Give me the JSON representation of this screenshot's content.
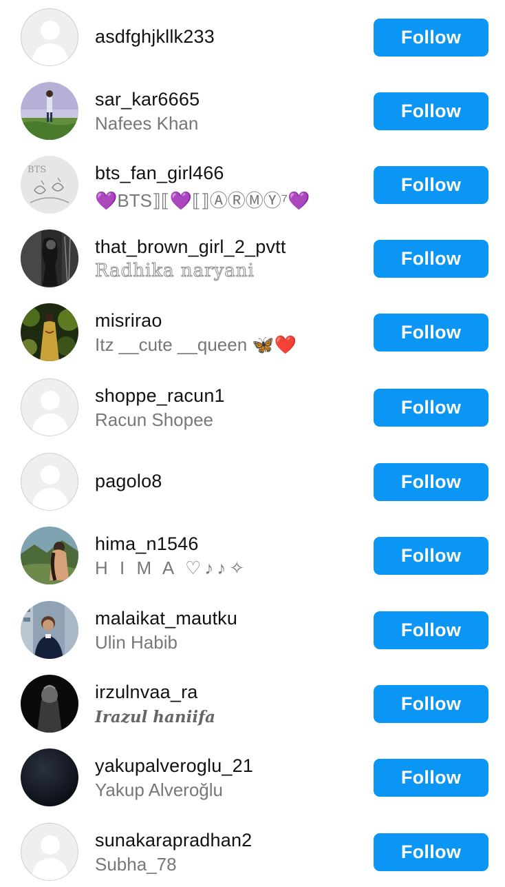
{
  "accounts": [
    {
      "username": "asdfghjkllk233",
      "fullname": "",
      "avatar": "default-avatar-icon"
    },
    {
      "username": "sar_kar6665",
      "fullname": "Nafees Khan",
      "avatar": "photo"
    },
    {
      "username": "bts_fan_girl466",
      "fullname": "💜BTS⟧⟦💜⟦⟧ⒶⓇⓂⓎ⁷💜",
      "avatar": "photo"
    },
    {
      "username": "that_brown_girl_2_pvtt",
      "fullname": "Radhika naryani",
      "avatar": "photo"
    },
    {
      "username": "misrirao",
      "fullname": "Itz __cute __queen 🦋❤️",
      "avatar": "photo"
    },
    {
      "username": "shoppe_racun1",
      "fullname": "Racun Shopee",
      "avatar": "default-avatar-icon"
    },
    {
      "username": "pagolo8",
      "fullname": "",
      "avatar": "default-avatar-icon"
    },
    {
      "username": "hima_n1546",
      "fullname": "H I M A ♡♪♪✧",
      "avatar": "photo"
    },
    {
      "username": "malaikat_mautku",
      "fullname": "Ulin Habib",
      "avatar": "photo"
    },
    {
      "username": "irzulnvaa_ra",
      "fullname": "Irazul haniifa",
      "avatar": "photo"
    },
    {
      "username": "yakupalveroglu_21",
      "fullname": "Yakup Alveroğlu",
      "avatar": "photo"
    },
    {
      "username": "sunakarapradhan2",
      "fullname": "Subha_78",
      "avatar": "default-avatar-icon"
    }
  ],
  "follow_label": "Follow",
  "colors": {
    "follow_button": "#0b95f4",
    "username_text": "#111111",
    "fullname_text": "#777777"
  }
}
